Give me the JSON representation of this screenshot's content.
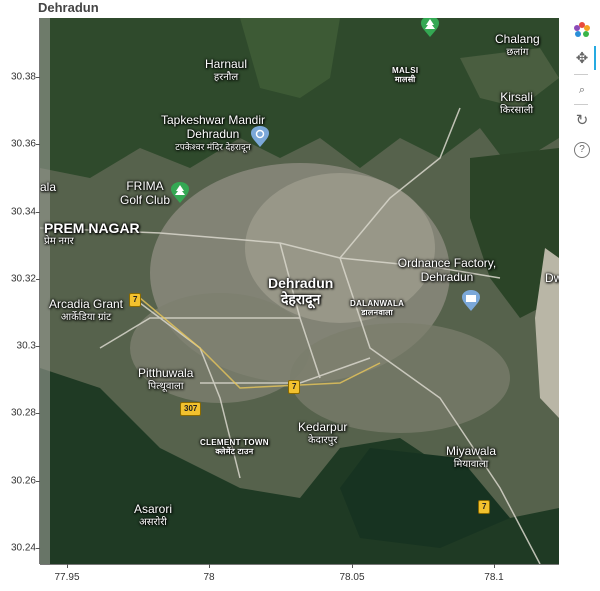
{
  "title": "Dehradun",
  "map": {
    "places": [
      {
        "id": "harnaul",
        "name": "Harnaul",
        "local": "हरनौल"
      },
      {
        "id": "malsi",
        "name": "MALSI",
        "local": "मालसी"
      },
      {
        "id": "chalang",
        "name": "Chalang",
        "local": "छलांग"
      },
      {
        "id": "kirsali",
        "name": "Kirsali",
        "local": "किरसाली"
      },
      {
        "id": "tapkeshwar",
        "name": "Tapkeshwar Mandir Dehradun",
        "local": "टपकेश्वर मंदिर देहरादून"
      },
      {
        "id": "frima",
        "name": "FRIMA Golf Club",
        "local": ""
      },
      {
        "id": "prem-nagar",
        "name": "PREM NAGAR",
        "local": "प्रेम नगर"
      },
      {
        "id": "dehradun",
        "name": "Dehradun",
        "local": "देहरादून"
      },
      {
        "id": "ordnance",
        "name": "Ordnance Factory, Dehradun",
        "local": ""
      },
      {
        "id": "dalanwala",
        "name": "DALANWALA",
        "local": "डालनवाला"
      },
      {
        "id": "arcadia",
        "name": "Arcadia Grant",
        "local": "आर्केडिया ग्रांट"
      },
      {
        "id": "pitthuwala",
        "name": "Pitthuwala",
        "local": "पित्थूवाला"
      },
      {
        "id": "clement",
        "name": "CLEMENT TOWN",
        "local": "क्लेमेंट टाउन"
      },
      {
        "id": "kedarpur",
        "name": "Kedarpur",
        "local": "केदारपुर"
      },
      {
        "id": "miyawala",
        "name": "Miyawala",
        "local": "मियावाला"
      },
      {
        "id": "asarori",
        "name": "Asarori",
        "local": "असरोरी"
      },
      {
        "id": "ala",
        "name": "ala",
        "local": ""
      },
      {
        "id": "dwa",
        "name": "Dw",
        "local": ""
      }
    ],
    "shields": [
      "7",
      "7",
      "307",
      "7"
    ],
    "xticks": [
      "77.95",
      "78",
      "78.05",
      "78.1"
    ],
    "yticks": [
      "30.38",
      "30.36",
      "30.34",
      "30.32",
      "30.3",
      "30.28",
      "30.26",
      "30.24"
    ]
  },
  "toolbar": {
    "tools": [
      {
        "name": "bokeh-logo",
        "icon": "❋"
      },
      {
        "name": "pan-tool",
        "icon": "✥"
      },
      {
        "name": "wheel-zoom-tool",
        "icon": "⌕"
      },
      {
        "name": "reset-tool",
        "icon": "↻"
      },
      {
        "name": "help-tool",
        "icon": "?"
      }
    ]
  }
}
